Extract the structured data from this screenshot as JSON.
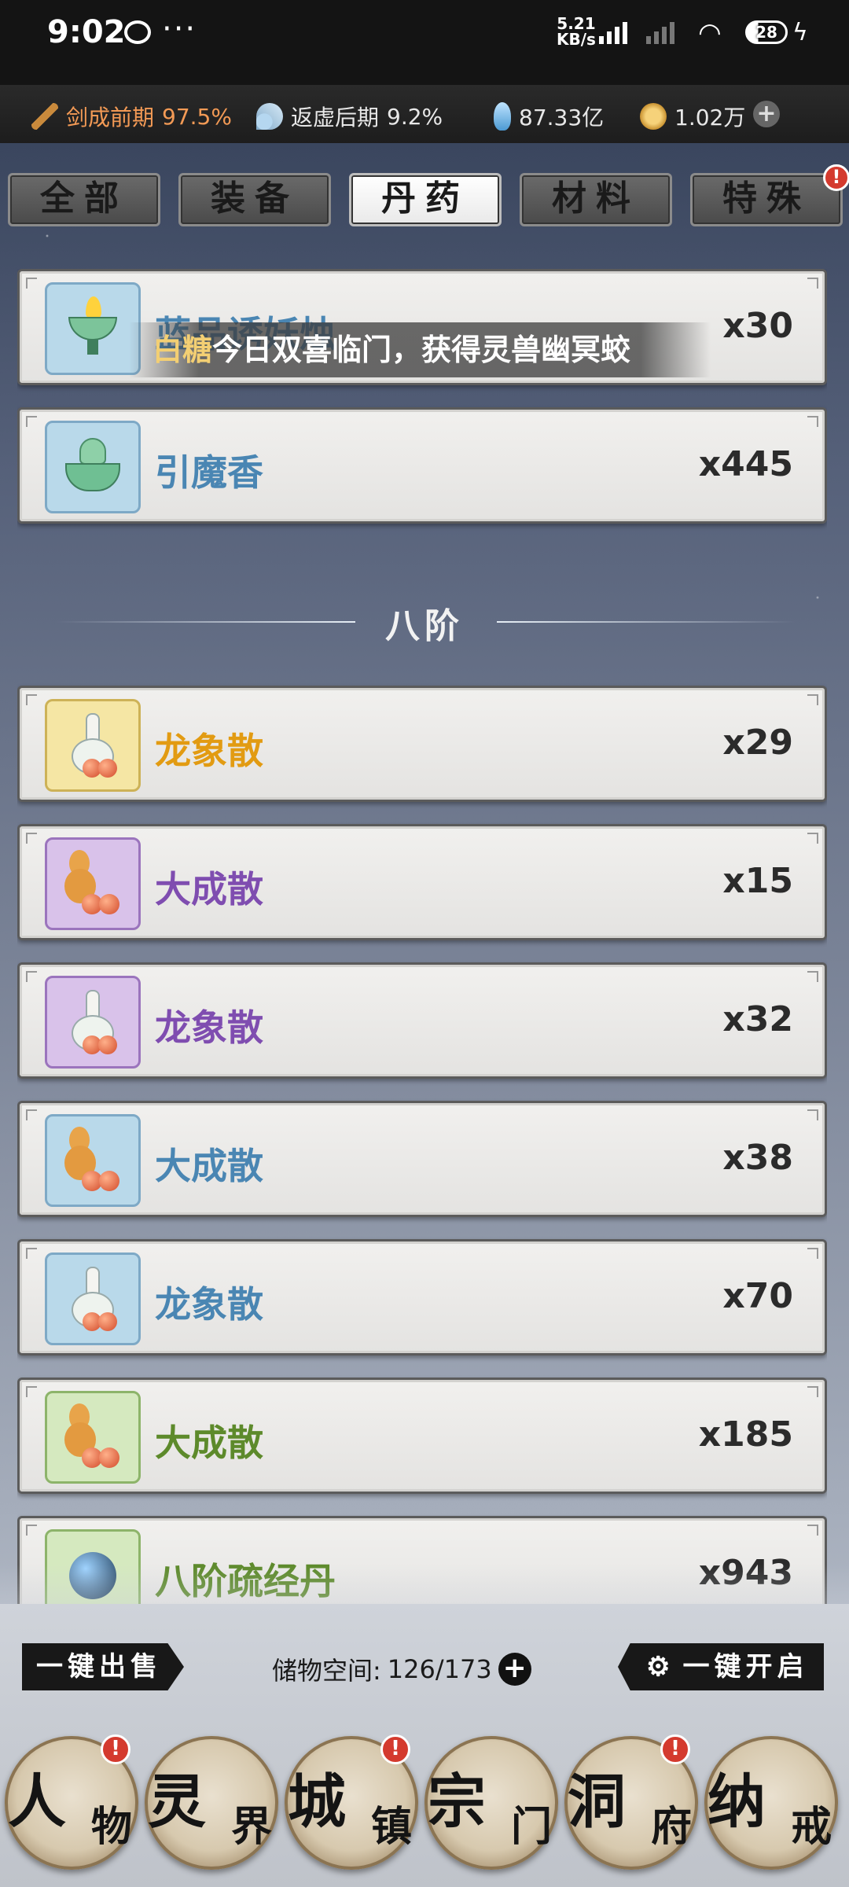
{
  "status_bar": {
    "time": "9:02",
    "more": "···",
    "net_speed_value": "5.21",
    "net_speed_unit": "KB/s",
    "battery": "28"
  },
  "resources": [
    {
      "icon": "sword-icon",
      "label": "剑成前期",
      "value": "97.5%"
    },
    {
      "icon": "fan-icon",
      "label": "返虚后期",
      "value": "9.2%"
    },
    {
      "icon": "spirit-stone-icon",
      "label": "87.33亿"
    },
    {
      "icon": "coin-icon",
      "label": "1.02万"
    }
  ],
  "tabs": [
    {
      "label": "全部",
      "active": false
    },
    {
      "label": "装备",
      "active": false
    },
    {
      "label": "丹药",
      "active": true
    },
    {
      "label": "材料",
      "active": false
    },
    {
      "label": "特殊",
      "active": false,
      "badge": "!"
    }
  ],
  "toast": {
    "who": "白糖",
    "msg": "今日双喜临门，获得灵兽幽冥蛟"
  },
  "section_label": "八阶",
  "items": [
    {
      "name": "蓝品诱妖烛",
      "count": "x30",
      "rarity": "blue",
      "icon": "lotus-candle-icon"
    },
    {
      "name": "引魔香",
      "count": "x445",
      "rarity": "blue",
      "icon": "incense-burner-icon"
    },
    {
      "name": "龙象散",
      "count": "x29",
      "rarity": "yellow",
      "icon": "vase-icon"
    },
    {
      "name": "大成散",
      "count": "x15",
      "rarity": "purple",
      "icon": "gourd-icon"
    },
    {
      "name": "龙象散",
      "count": "x32",
      "rarity": "purple",
      "icon": "vase-icon"
    },
    {
      "name": "大成散",
      "count": "x38",
      "rarity": "blue",
      "icon": "gourd-icon"
    },
    {
      "name": "龙象散",
      "count": "x70",
      "rarity": "blue",
      "icon": "vase-icon"
    },
    {
      "name": "大成散",
      "count": "x185",
      "rarity": "green",
      "icon": "gourd-icon"
    },
    {
      "name": "八阶疏经丹",
      "count": "x943",
      "rarity": "green",
      "icon": "orb-icon"
    }
  ],
  "footer": {
    "sell_all": "一键出售",
    "storage_label": "储物空间:",
    "storage_value": "126/173",
    "open_all": "一键开启"
  },
  "nav": [
    {
      "big": "人",
      "small": "物",
      "badge": "!"
    },
    {
      "big": "灵",
      "small": "界",
      "badge": ""
    },
    {
      "big": "城",
      "small": "镇",
      "badge": "!"
    },
    {
      "big": "宗",
      "small": "门",
      "badge": ""
    },
    {
      "big": "洞",
      "small": "府",
      "badge": "!"
    },
    {
      "big": "纳",
      "small": "戒",
      "badge": ""
    }
  ],
  "colors": {
    "blue": "#4a86b3",
    "yellow": "#e29b12",
    "purple": "#7f4db0",
    "green": "#5d8a2b",
    "badge_red": "#d43a2e"
  }
}
